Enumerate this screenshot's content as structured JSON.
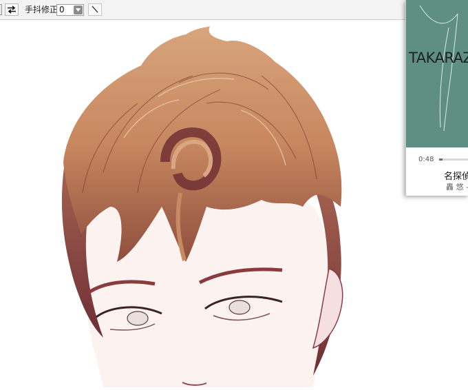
{
  "toolbar": {
    "stabilizer_label": "手抖修正",
    "stabilizer_value": "0",
    "icons": [
      "swap-arrows-icon",
      "dropdown-arrow-icon",
      "line-tool-icon"
    ]
  },
  "artwork": {
    "description_icon": "portrait-illustration"
  },
  "player": {
    "cover_text": "TAKARAZ",
    "time": "0:48",
    "progress": 0.12,
    "song_title": "名探偵",
    "artist": "轟 悠 -",
    "cover_color": "#5f8e83"
  }
}
